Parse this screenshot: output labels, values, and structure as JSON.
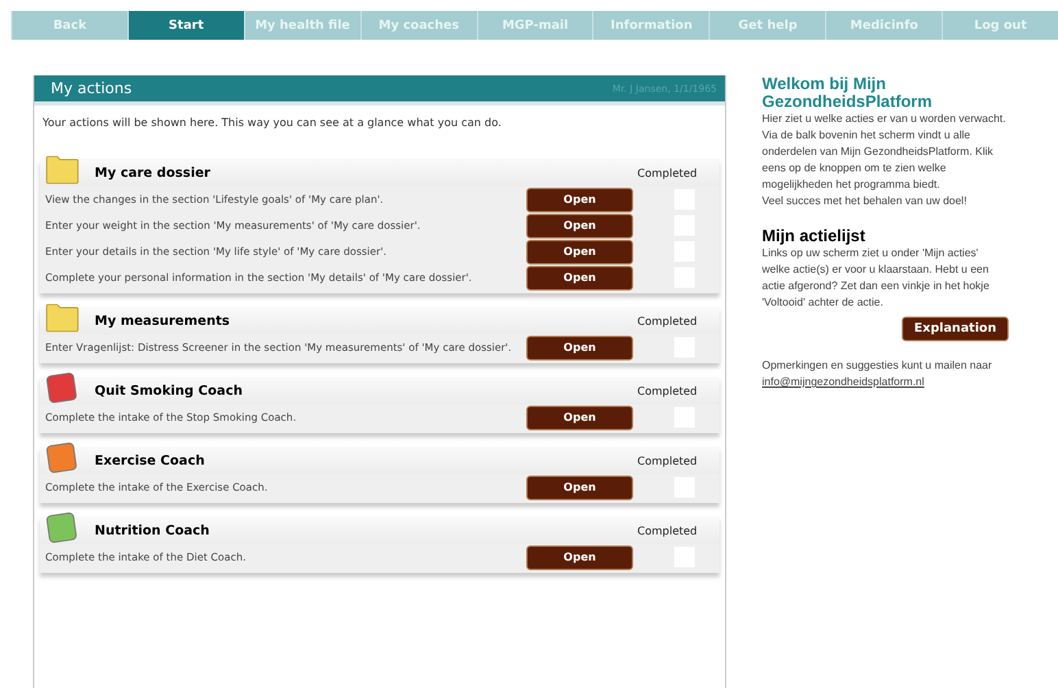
{
  "nav": [
    {
      "label": "Back",
      "selected": false
    },
    {
      "label": "Start",
      "selected": true
    },
    {
      "label": "My health file",
      "selected": false
    },
    {
      "label": "My coaches",
      "selected": false
    },
    {
      "label": "MGP-mail",
      "selected": false
    },
    {
      "label": "Information",
      "selected": false
    },
    {
      "label": "Get help",
      "selected": false
    },
    {
      "label": "Medicinfo",
      "selected": false
    },
    {
      "label": "Log out",
      "selected": false
    }
  ],
  "panel": {
    "title": "My actions",
    "user": "Mr. J Jansen, 1/1/1965",
    "intro": "Your actions will be shown here. This way you can see at a glance what you can do."
  },
  "sections": [
    {
      "title": "My care dossier",
      "kind": "folder",
      "color": "#f2d75a",
      "completed_label": "Completed",
      "actions": [
        {
          "text": "View the changes in the section 'Lifestyle goals' of 'My care plan'.",
          "button": "Open",
          "checked": false
        },
        {
          "text": "Enter your weight in the section 'My measurements' of 'My care dossier'.",
          "button": "Open",
          "checked": false
        },
        {
          "text": "Enter your details in the section 'My life style' of 'My care dossier'.",
          "button": "Open",
          "checked": false
        },
        {
          "text": "Complete your personal information in the section 'My details' of 'My care dossier'.",
          "button": "Open",
          "checked": false
        }
      ]
    },
    {
      "title": "My measurements",
      "kind": "folder",
      "color": "#f2d75a",
      "completed_label": "Completed",
      "actions": [
        {
          "text": "Enter Vragenlijst: Distress Screener in the section 'My measurements' of 'My care dossier'.",
          "button": "Open",
          "checked": false
        }
      ]
    },
    {
      "title": "Quit Smoking Coach",
      "kind": "coach",
      "color": "#e03a3a",
      "completed_label": "Completed",
      "actions": [
        {
          "text": "Complete the intake of the Stop Smoking Coach.",
          "button": "Open",
          "checked": false
        }
      ]
    },
    {
      "title": "Exercise Coach",
      "kind": "coach",
      "color": "#ef7d2a",
      "completed_label": "Completed",
      "actions": [
        {
          "text": "Complete the intake of the Exercise Coach.",
          "button": "Open",
          "checked": false
        }
      ]
    },
    {
      "title": "Nutrition Coach",
      "kind": "coach",
      "color": "#7cc35a",
      "completed_label": "Completed",
      "actions": [
        {
          "text": "Complete the intake of the Diet Coach.",
          "button": "Open",
          "checked": false
        }
      ]
    }
  ],
  "sidebar": {
    "welcome_title": "Welkom bij Mijn GezondheidsPlatform",
    "welcome_text": "Hier ziet u welke acties er van u worden verwacht. Via de balk bovenin het scherm vindt u alle onderdelen van Mijn GezondheidsPlatform. Klik eens op de knoppen om te zien welke mogelijkheden het programma biedt.",
    "wish": "Veel succes met het behalen van uw doel!",
    "list_title": "Mijn actielijst",
    "list_text": "Links op uw scherm ziet u onder 'Mijn acties' welke actie(s) er voor u klaarstaan. Hebt u een actie afgerond? Zet dan een vinkje in het hokje 'Voltooid' achter de actie.",
    "button": "Explanation",
    "contact_text": "Opmerkingen en suggesties kunt u mailen naar",
    "email": "info@mijngezondheidsplatform.nl"
  }
}
